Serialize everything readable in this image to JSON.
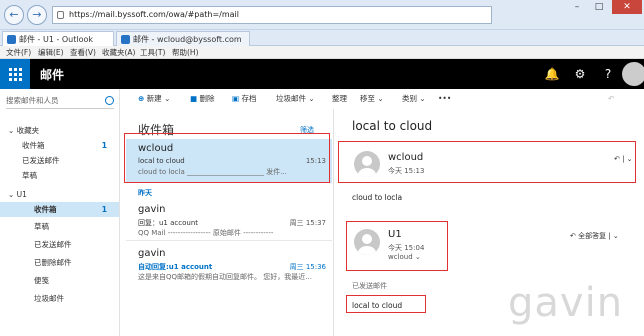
{
  "browser": {
    "url": "https://mail.byssoft.com/owa/#path=/mail",
    "tabs": [
      {
        "label": "邮件 - U1 - Outlook"
      },
      {
        "label": "邮件 - wcloud@byssoft.com"
      }
    ],
    "menu": [
      "文件(F)",
      "编辑(E)",
      "查看(V)",
      "收藏夹(A)",
      "工具(T)",
      "帮助(H)"
    ]
  },
  "appbar": {
    "title": "邮件",
    "icons": [
      "bell-icon",
      "gear-icon",
      "help-icon"
    ]
  },
  "leftnav": {
    "search_placeholder": "搜索邮件和人员",
    "items": [
      {
        "label": "收藏夹",
        "count": ""
      },
      {
        "label": "收件箱",
        "count": "1"
      },
      {
        "label": "已发送邮件",
        "count": ""
      },
      {
        "label": "草稿",
        "count": ""
      },
      {
        "label": "U1",
        "count": ""
      },
      {
        "label": "收件箱",
        "count": "1"
      },
      {
        "label": "草稿",
        "count": ""
      },
      {
        "label": "已发送邮件",
        "count": ""
      },
      {
        "label": "已删除邮件",
        "count": ""
      },
      {
        "label": "便笺",
        "count": ""
      },
      {
        "label": "垃圾邮件",
        "count": ""
      }
    ]
  },
  "toolbar": {
    "new": "新建",
    "delete": "删除",
    "archive": "存档",
    "junk": "垃圾邮件",
    "sweep": "整理",
    "move": "移至",
    "categories": "类别",
    "more": "•••"
  },
  "list": {
    "title": "收件箱",
    "filter": "筛选",
    "group_yesterday": "昨天",
    "messages": [
      {
        "sender": "wcloud",
        "subject": "local to cloud",
        "preview": "cloud to locla ______________________ 发件...",
        "date": "15:13"
      },
      {
        "sender": "gavin",
        "subject": "回复：u1 account",
        "preview": "QQ Mail ----------------- 原始邮件 ------------",
        "date": "周三 15:37"
      },
      {
        "sender": "gavin",
        "subject": "自动回复:u1 account",
        "preview": "这是来自QQ邮箱的假期自动回复邮件。 您好，我最近...",
        "date": "周三 15:36"
      }
    ]
  },
  "reading": {
    "title": "local to cloud",
    "first": {
      "name": "wcloud",
      "time": "今天 15:13",
      "body": "cloud to locla"
    },
    "second": {
      "name": "U1",
      "time": "今天 15:04",
      "to": "wcloud",
      "reply_all": "全部答复",
      "sent_label": "已发送邮件",
      "quoted": "local to cloud"
    }
  },
  "watermark": "gavin"
}
